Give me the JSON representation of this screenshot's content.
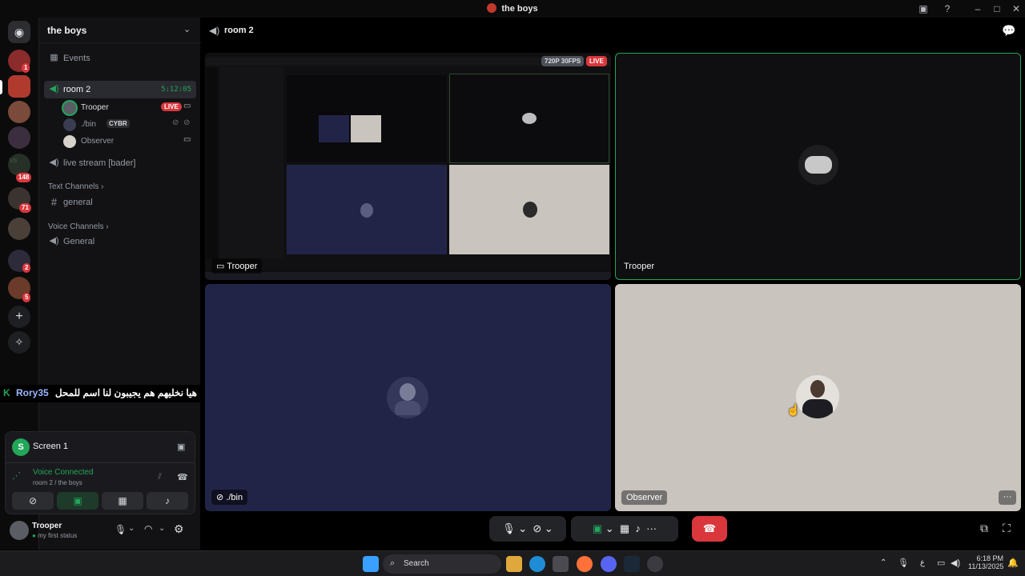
{
  "window": {
    "title": "the boys"
  },
  "rail": {
    "badges": [
      "1",
      "148",
      "71",
      "2",
      "5"
    ],
    "dm_label": "VS"
  },
  "sidebar": {
    "server_name": "the boys",
    "events_label": "Events",
    "voice_channel": {
      "name": "room 2",
      "timer": "5:12:05"
    },
    "users": [
      {
        "name": "Trooper",
        "badge": "LIVE"
      },
      {
        "name": "./bin",
        "tag": "CYBR"
      },
      {
        "name": "Observer"
      }
    ],
    "live_stream_channel": "live stream [bader]",
    "text_category": "Text Channels",
    "text_channels": [
      "general"
    ],
    "voice_category": "Voice Channels",
    "voice_channels": [
      "General"
    ]
  },
  "chat_overlay": {
    "user": "Rory35",
    "message": "هيا نخليهم هم يجيبون لنا اسم للمحل اللي :"
  },
  "panel": {
    "screen_label": "Screen 1",
    "status": "Voice Connected",
    "location": "room 2 / the boys"
  },
  "userbar": {
    "username": "Trooper",
    "status": "my first status"
  },
  "stage": {
    "channel": "room 2",
    "stream_quality": "720P 30FPS",
    "live_badge": "LIVE",
    "tiles": [
      {
        "label": "Trooper"
      },
      {
        "label": "Trooper"
      },
      {
        "label": "./bin"
      },
      {
        "label": "Observer"
      }
    ]
  },
  "taskbar": {
    "search_placeholder": "Search",
    "time": "6:18 PM",
    "date": "11/13/2025",
    "lang": "ع"
  },
  "colors": {
    "accent_green": "#23a55a",
    "live_red": "#da373c",
    "tile_navy": "#222447",
    "tile_beige": "#c9c4bd",
    "hangup": "#da373c"
  }
}
